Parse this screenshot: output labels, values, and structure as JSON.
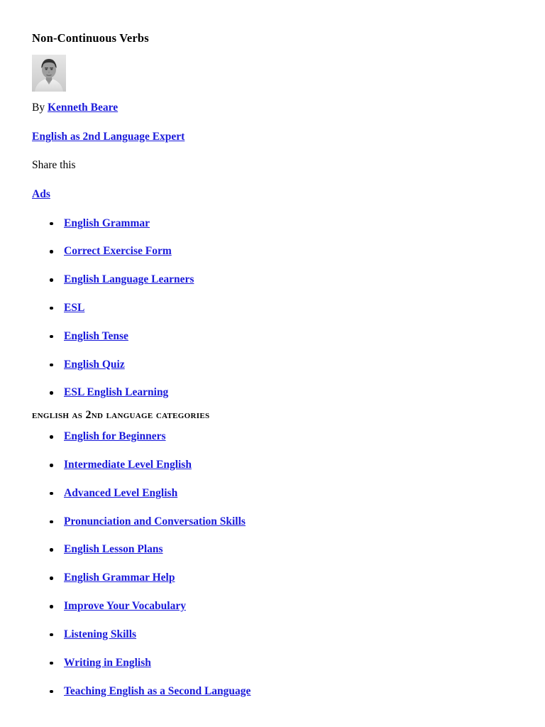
{
  "document": {
    "title": "Non-Continuous Verbs",
    "byline_prefix": "By",
    "author_name": "Kenneth Beare",
    "author_role": "English as 2nd Language Expert",
    "share_label": "Share this",
    "avatar_alt": "author-headshot"
  },
  "colors": {
    "link": "#1b1bdb",
    "text": "#000000",
    "background": "#ffffff"
  },
  "ads": {
    "heading": "Ads",
    "items": [
      {
        "label": "English Grammar"
      },
      {
        "label": "Correct Exercise Form"
      },
      {
        "label": "English Language Learners"
      },
      {
        "label": "ESL"
      },
      {
        "label": "English Tense"
      },
      {
        "label": "English Quiz"
      },
      {
        "label": "ESL English Learning"
      }
    ]
  },
  "categories": {
    "heading": "English as 2nd Language Categories",
    "items": [
      {
        "label": "English for Beginners"
      },
      {
        "label": "Intermediate Level English"
      },
      {
        "label": "Advanced Level English"
      },
      {
        "label": "Pronunciation and Conversation Skills"
      },
      {
        "label": "English Lesson Plans"
      },
      {
        "label": "English Grammar Help"
      },
      {
        "label": "Improve Your Vocabulary"
      },
      {
        "label": "Listening Skills"
      },
      {
        "label": "Writing in English"
      },
      {
        "label": "Teaching English as a Second Language"
      }
    ]
  }
}
